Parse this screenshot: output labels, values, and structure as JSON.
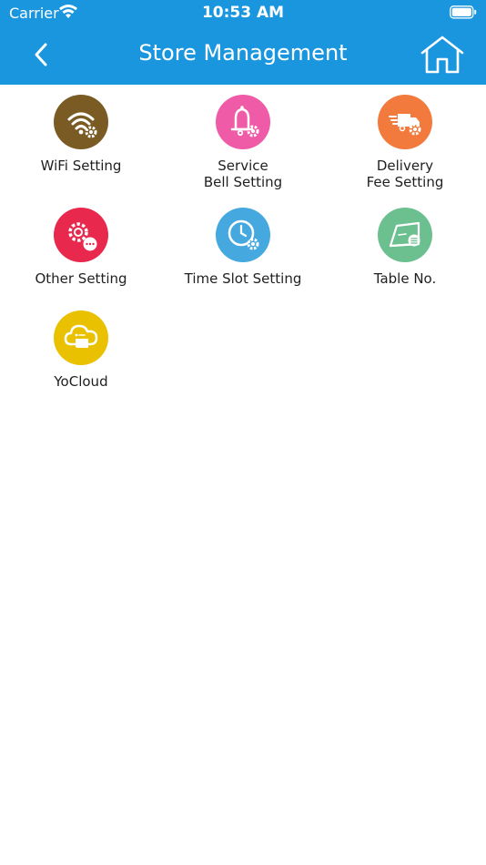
{
  "status_bar": {
    "carrier": "Carrier",
    "time": "10:53 AM"
  },
  "nav": {
    "title": "Store Management",
    "back_icon": "chevron-left-icon",
    "home_icon": "home-icon"
  },
  "colors": {
    "header": "#1a96df",
    "wifi": "#7a5b23",
    "service_bell": "#ef5ba7",
    "delivery": "#f27a3c",
    "other": "#e8294d",
    "time_slot": "#45a9e0",
    "table_no": "#6cc08f",
    "yocloud": "#e9c100"
  },
  "tiles": [
    {
      "label": "WiFi Setting",
      "icon": "wifi-gear-icon"
    },
    {
      "label": "Service\nBell Setting",
      "icon": "bell-gear-icon"
    },
    {
      "label": "Delivery\nFee Setting",
      "icon": "delivery-truck-gear-icon"
    },
    {
      "label": "Other Setting",
      "icon": "gears-more-icon"
    },
    {
      "label": "Time Slot Setting",
      "icon": "clock-gear-icon"
    },
    {
      "label": "Table No.",
      "icon": "table-card-icon"
    },
    {
      "label": "YoCloud",
      "icon": "cloud-icon"
    }
  ]
}
